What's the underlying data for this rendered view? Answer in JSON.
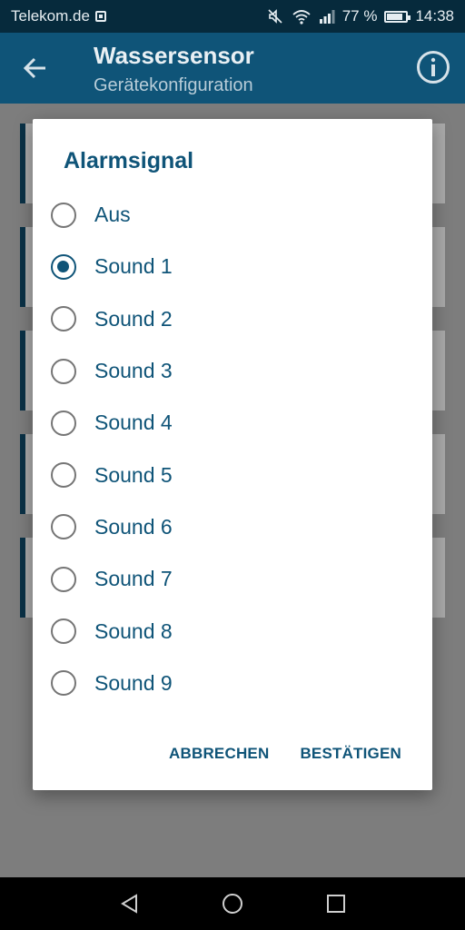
{
  "status_bar": {
    "carrier": "Telekom.de",
    "battery": "77 %",
    "time": "14:38"
  },
  "app_bar": {
    "title": "Wassersensor",
    "subtitle": "Gerätekonfiguration"
  },
  "dialog": {
    "title": "Alarmsignal",
    "options": [
      {
        "label": "Aus",
        "selected": false
      },
      {
        "label": "Sound 1",
        "selected": true
      },
      {
        "label": "Sound 2",
        "selected": false
      },
      {
        "label": "Sound 3",
        "selected": false
      },
      {
        "label": "Sound 4",
        "selected": false
      },
      {
        "label": "Sound 5",
        "selected": false
      },
      {
        "label": "Sound 6",
        "selected": false
      },
      {
        "label": "Sound 7",
        "selected": false
      },
      {
        "label": "Sound 8",
        "selected": false
      },
      {
        "label": "Sound 9",
        "selected": false
      }
    ],
    "cancel_label": "ABBRECHEN",
    "confirm_label": "BESTÄTIGEN"
  },
  "colors": {
    "primary": "#0f5478",
    "status_bar": "#062a3c"
  }
}
